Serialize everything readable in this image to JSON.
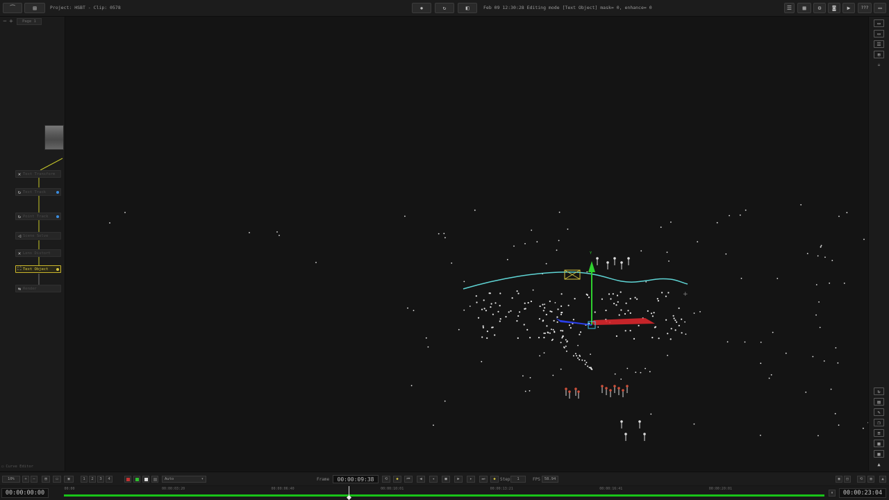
{
  "topbar": {
    "project_label": "Project: HSBT - Clip: 0578",
    "status_text": "Feb 09 12:30:28 Editing mode [Text Object] mask= 0, enhance= 0",
    "help_label": "???"
  },
  "node_panel": {
    "page_tab": "Page 1",
    "nodes": [
      {
        "label": "Text Transform",
        "icon": "transform-icon",
        "dot_color": "",
        "active": false
      },
      {
        "label": "Text Track",
        "icon": "track-icon",
        "dot_color": "#3a8de0",
        "active": false
      },
      {
        "label": "Point Track",
        "icon": "track-icon",
        "dot_color": "#3a8de0",
        "active": false
      },
      {
        "label": "Scene Solve",
        "icon": "solve-icon",
        "dot_color": "",
        "active": false
      },
      {
        "label": "Lens Distort",
        "icon": "transform-icon",
        "dot_color": "",
        "active": false
      },
      {
        "label": "Text Object",
        "icon": "object-icon",
        "dot_color": "#d8c840",
        "active": true
      },
      {
        "label": "Render",
        "icon": "render-icon",
        "dot_color": "",
        "active": false
      }
    ],
    "curve_editor_label": "Curve Editor"
  },
  "controls": {
    "zoom_value": "10%",
    "layer_buttons": [
      "1",
      "2",
      "3",
      "4"
    ],
    "mode_select": "Auto",
    "frame_label": "Frame",
    "frame_value": "00:00:09:38",
    "step_label": "Step",
    "step_value": "1",
    "fps_label": "FPS",
    "fps_value": "58.94"
  },
  "timeline": {
    "start_tc": "00:00:00:00",
    "end_tc": "00:00:23:04",
    "ticks": [
      "00:00",
      "00:00:03:20",
      "00:00:06:40",
      "00:00:10:01",
      "00:00:13:21",
      "00:00:16:41",
      "00:00:20:01"
    ],
    "playhead_fraction": 0.374
  },
  "colors": {
    "accent_yellow": "#d8c840",
    "track_green": "#19c419",
    "axis_x": "#d8262b",
    "axis_y": "#2fd12f",
    "axis_z": "#2a3fe8",
    "path_cyan": "#5fd6d6"
  }
}
